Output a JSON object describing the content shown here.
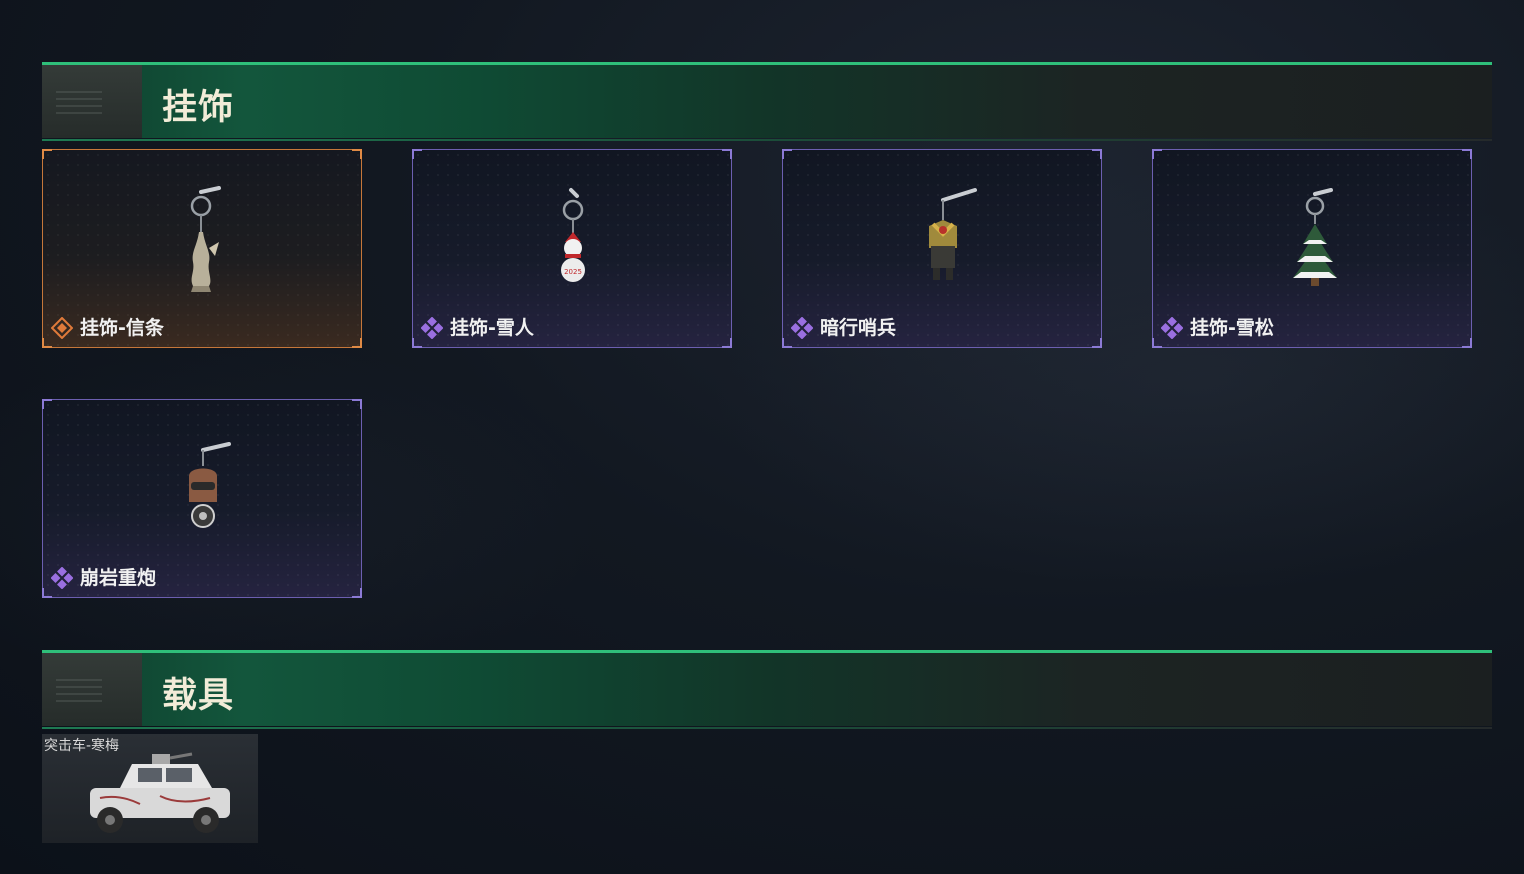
{
  "sections": {
    "charms": {
      "title": "挂饰"
    },
    "vehicles": {
      "title": "载具"
    }
  },
  "charms": [
    {
      "name": "挂饰-信条",
      "rarity": "legendary",
      "rarity_color": "#e07a3a",
      "icon": "charm-creed-icon"
    },
    {
      "name": "挂饰-雪人",
      "rarity": "epic",
      "rarity_color": "#9a6fe0",
      "icon": "charm-snowman-icon"
    },
    {
      "name": "暗行哨兵",
      "rarity": "epic",
      "rarity_color": "#9a6fe0",
      "icon": "charm-sentinel-icon"
    },
    {
      "name": "挂饰-雪松",
      "rarity": "epic",
      "rarity_color": "#9a6fe0",
      "icon": "charm-snow-pine-icon"
    },
    {
      "name": "崩岩重炮",
      "rarity": "epic",
      "rarity_color": "#9a6fe0",
      "icon": "charm-heavy-cannon-icon"
    }
  ],
  "vehicles": [
    {
      "name": "突击车-寒梅",
      "icon": "assault-vehicle-icon"
    }
  ],
  "colors": {
    "header_accent": "#2fbf7a",
    "legendary": "#e07a3a",
    "epic": "#9a6fe0"
  }
}
